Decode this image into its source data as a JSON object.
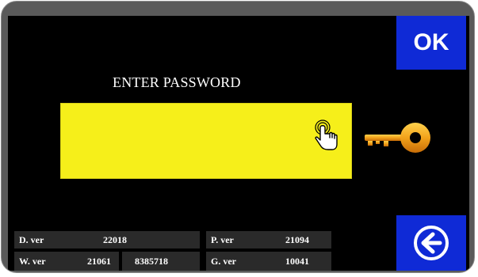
{
  "header": {
    "title": "ENTER PASSWORD",
    "ok_label": "OK"
  },
  "password": {
    "value": "",
    "field_color": "#f6ef1a"
  },
  "versions": {
    "d_ver": {
      "label": "D. ver",
      "value": "22018"
    },
    "p_ver": {
      "label": "P. ver",
      "value": "21094"
    },
    "w_ver": {
      "label": "W. ver",
      "value": "21061",
      "extra": "8385718"
    },
    "g_ver": {
      "label": "G. ver",
      "value": "10041"
    }
  },
  "icons": {
    "tap": "touch-hand-icon",
    "key": "key-icon",
    "back": "back-arrow-icon"
  },
  "colors": {
    "button_blue": "#0f2ad6",
    "screen_bg": "#000000",
    "key_gold": "#f2a21b"
  }
}
